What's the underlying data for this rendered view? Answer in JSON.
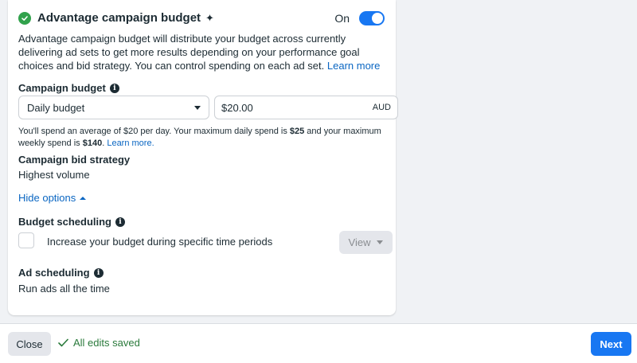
{
  "campaign_budget_section": {
    "title": "Advantage campaign budget",
    "toggle_label": "On",
    "toggle_on": true,
    "description": "Advantage campaign budget will distribute your budget across currently delivering ad sets to get more results depending on your performance goal choices and bid strategy. You can control spending on each ad set.",
    "learn_more": "Learn more"
  },
  "budget": {
    "label": "Campaign budget",
    "type_selected": "Daily budget",
    "amount": "$20.00",
    "currency": "AUD",
    "note_part1": "You'll spend an average of $20 per day. Your maximum daily spend is ",
    "max_daily": "$25",
    "note_part2": " and your maximum weekly spend is ",
    "max_weekly": "$140",
    "note_part3": ".",
    "learn_more": "Learn more."
  },
  "bid_strategy": {
    "label": "Campaign bid strategy",
    "value": "Highest volume"
  },
  "hide_options": "Hide options",
  "budget_scheduling": {
    "label": "Budget scheduling",
    "checkbox_label": "Increase your budget during specific time periods",
    "checked": false,
    "view_button": "View"
  },
  "ad_scheduling": {
    "label": "Ad scheduling",
    "value": "Run ads all the time"
  },
  "footer": {
    "close": "Close",
    "status": "All edits saved",
    "next": "Next"
  },
  "colors": {
    "accent": "#1877f2",
    "success": "#31a24c",
    "link": "#0a66c2"
  }
}
